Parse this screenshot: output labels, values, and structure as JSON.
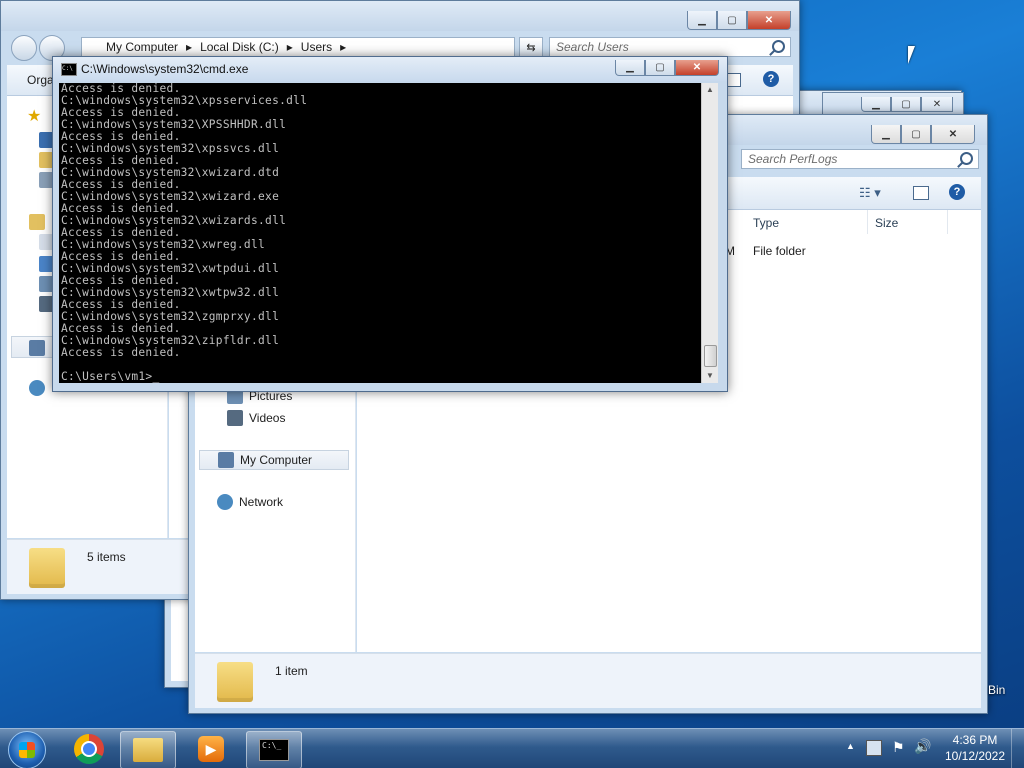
{
  "users_window": {
    "breadcrumb": [
      "My Computer",
      "Local Disk (C:)",
      "Users"
    ],
    "search_placeholder": "Search Users",
    "toolbar_organize": "Orga",
    "status_count": "5 items"
  },
  "perflogs_window": {
    "search_placeholder": "Search PerfLogs",
    "columns": {
      "type": "Type",
      "size": "Size"
    },
    "row": {
      "date_fragment": "M",
      "type": "File folder"
    },
    "nav": {
      "pictures": "Pictures",
      "videos": "Videos",
      "my_computer": "My Computer",
      "network": "Network"
    },
    "status_count": "1 item"
  },
  "cmd_window": {
    "title": "C:\\Windows\\system32\\cmd.exe",
    "lines": [
      "Access is denied.",
      "C:\\windows\\system32\\xpsservices.dll",
      "Access is denied.",
      "C:\\windows\\system32\\XPSSHHDR.dll",
      "Access is denied.",
      "C:\\windows\\system32\\xpssvcs.dll",
      "Access is denied.",
      "C:\\windows\\system32\\xwizard.dtd",
      "Access is denied.",
      "C:\\windows\\system32\\xwizard.exe",
      "Access is denied.",
      "C:\\windows\\system32\\xwizards.dll",
      "Access is denied.",
      "C:\\windows\\system32\\xwreg.dll",
      "Access is denied.",
      "C:\\windows\\system32\\xwtpdui.dll",
      "Access is denied.",
      "C:\\windows\\system32\\xwtpw32.dll",
      "Access is denied.",
      "C:\\windows\\system32\\zgmprxy.dll",
      "Access is denied.",
      "C:\\windows\\system32\\zipfldr.dll",
      "Access is denied.",
      "",
      "C:\\Users\\vm1>_"
    ]
  },
  "desktop": {
    "recycle_bin_fragment": "Bin"
  },
  "taskbar": {
    "time": "4:36 PM",
    "date": "10/12/2022",
    "cmd_icon_text": "C:\\_"
  },
  "colors": {
    "console_bg": "#000000",
    "console_fg": "#c0c0c0",
    "close_red": "#c4402a"
  }
}
